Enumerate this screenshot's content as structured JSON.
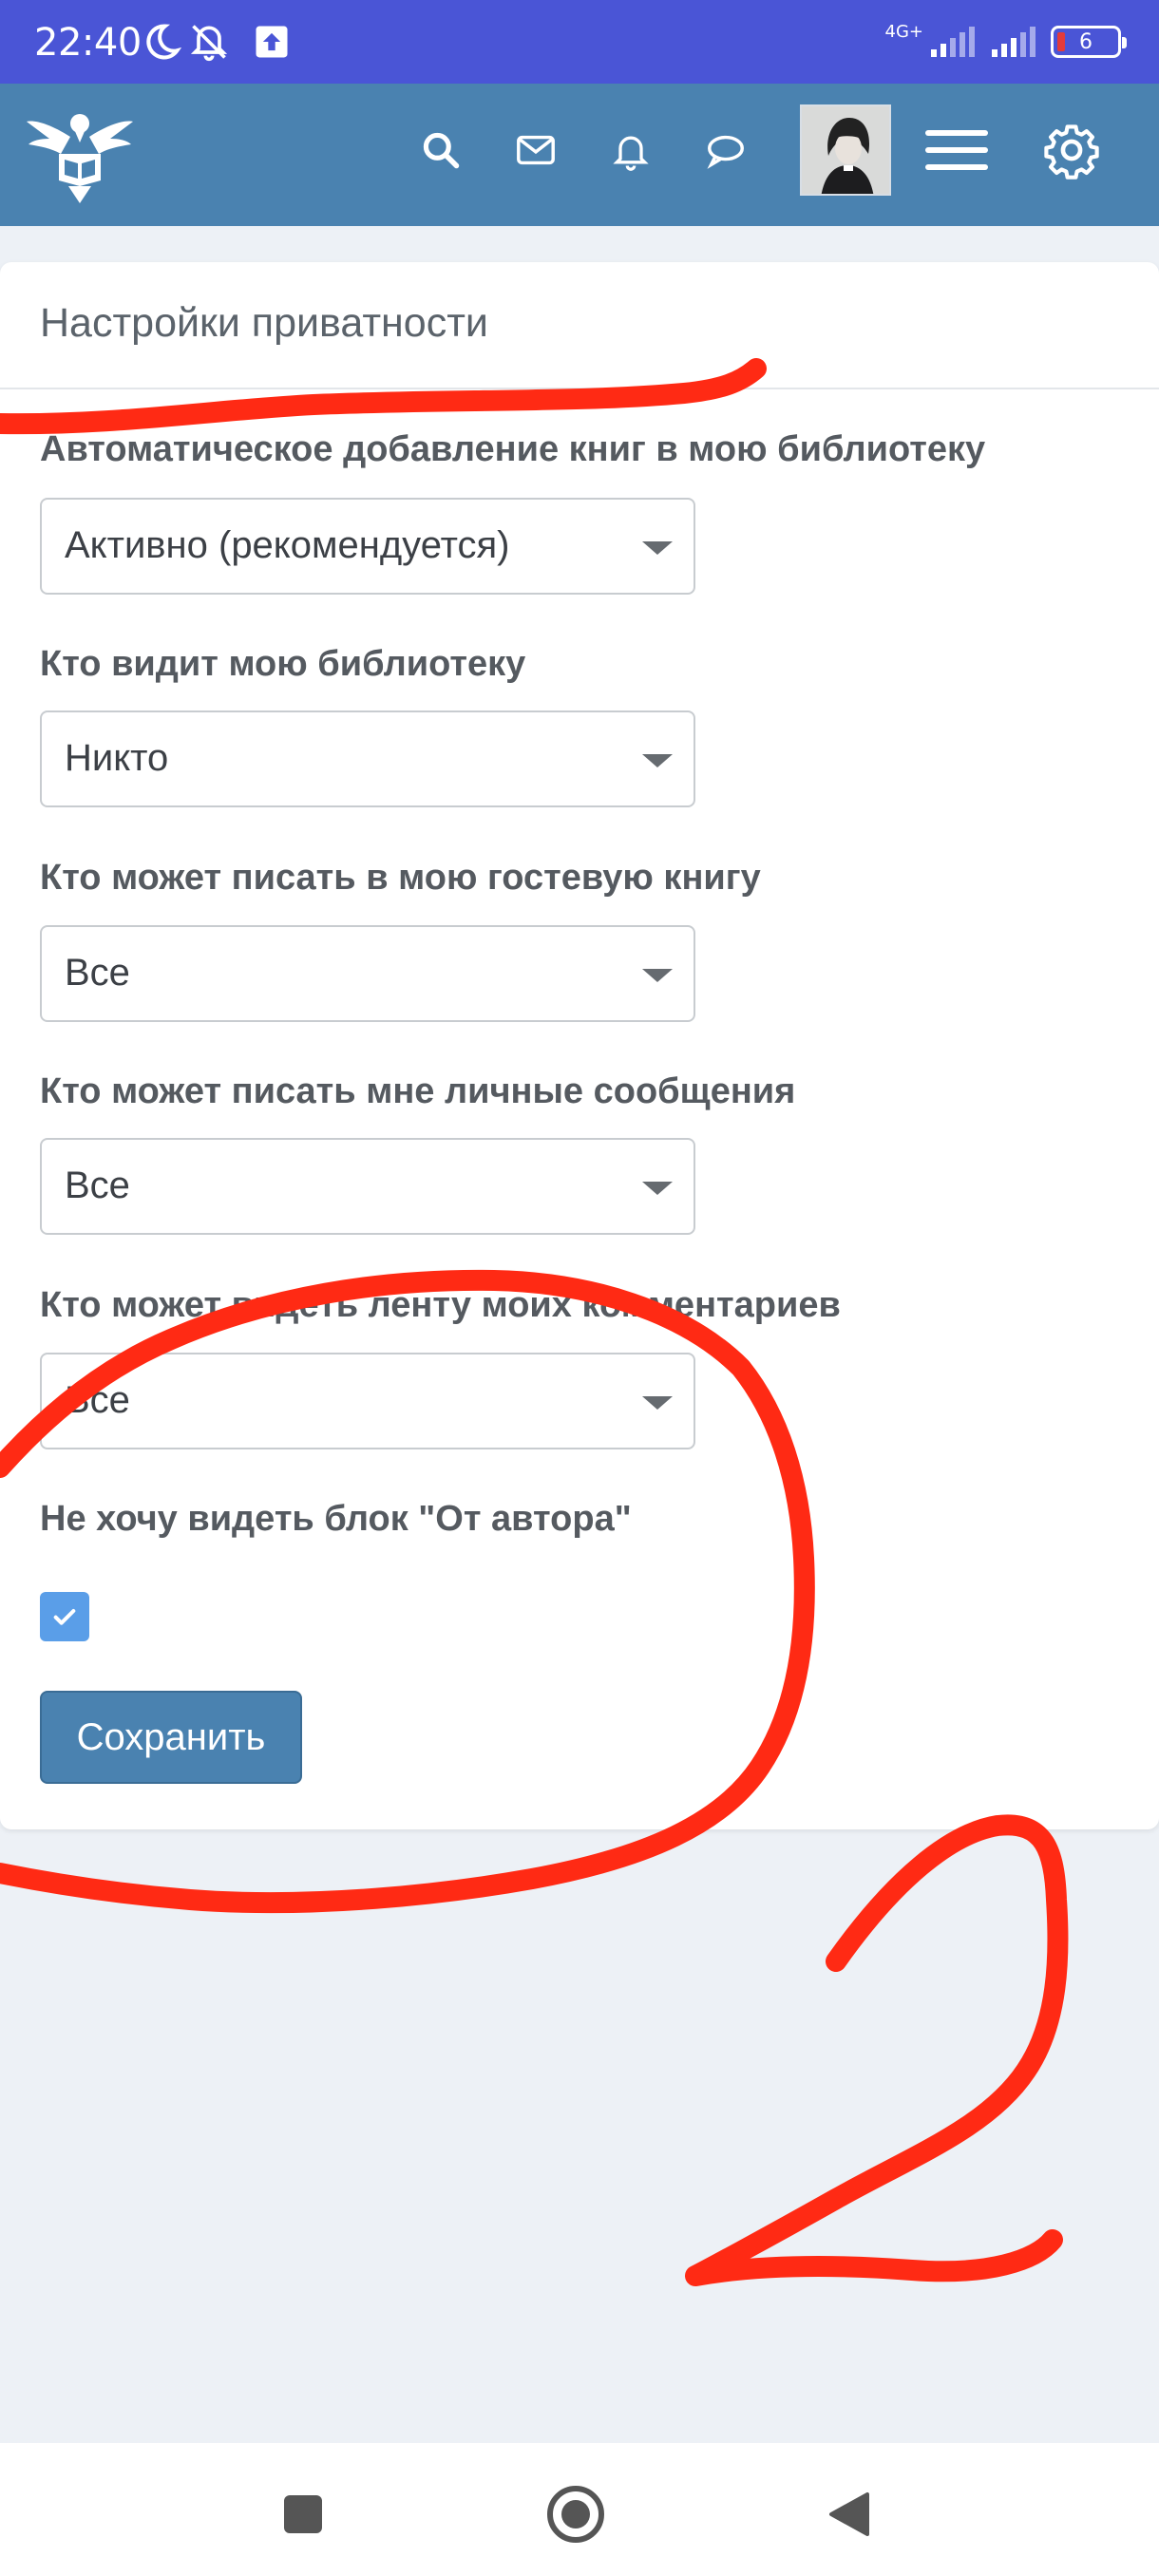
{
  "status_bar": {
    "time": "22:40",
    "network": "4G+",
    "battery": "6"
  },
  "header": {
    "icons": [
      "search-icon",
      "mail-icon",
      "bell-icon",
      "chat-icon",
      "hamburger-menu-icon",
      "gear-icon"
    ]
  },
  "page": {
    "title": "Настройки приватности",
    "fields": [
      {
        "label": "Автоматическое добавление книг в мою библиотеку",
        "value": "Активно (рекомендуется)"
      },
      {
        "label": "Кто видит мою библиотеку",
        "value": "Никто"
      },
      {
        "label": "Кто может писать в мою гостевую книгу",
        "value": "Все"
      },
      {
        "label": "Кто может писать мне личные сообщения",
        "value": "Все"
      },
      {
        "label": "Кто может видеть ленту моих комментариев",
        "value": "Все"
      }
    ],
    "checkbox_label": "Не хочу видеть блок \"От автора\"",
    "checkbox_checked": true,
    "save_label": "Сохранить"
  },
  "colors": {
    "status_bar": "#4a55d6",
    "header": "#4a82b0",
    "accent": "#5a9ee8",
    "annotation": "#ff2a14"
  }
}
